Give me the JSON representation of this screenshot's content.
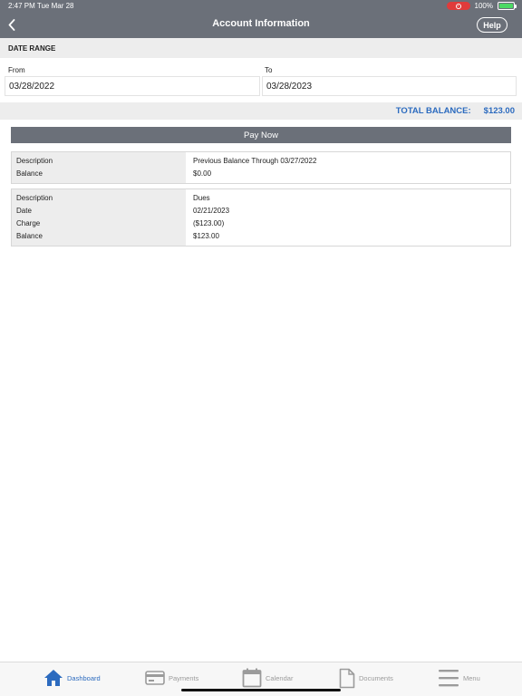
{
  "status": {
    "time_date": "2:47 PM   Tue Mar 28",
    "battery": "100%"
  },
  "nav": {
    "title": "Account Information",
    "help_label": "Help"
  },
  "date_range": {
    "section_title": "DATE RANGE",
    "from_label": "From",
    "from_value": "03/28/2022",
    "to_label": "To",
    "to_value": "03/28/2023"
  },
  "total_balance": {
    "label": "TOTAL BALANCE:",
    "value": "$123.00"
  },
  "pay_now_label": "Pay Now",
  "entries": [
    {
      "labels": [
        "Description",
        "Balance"
      ],
      "values": [
        "Previous Balance Through 03/27/2022",
        "$0.00"
      ]
    },
    {
      "labels": [
        "Description",
        "Date",
        "Charge",
        "Balance"
      ],
      "values": [
        "Dues",
        "02/21/2023",
        "($123.00)",
        "$123.00"
      ]
    }
  ],
  "tabs": [
    {
      "label": "Dashboard",
      "icon": "home-icon",
      "active": true
    },
    {
      "label": "Payments",
      "icon": "credit-card-icon",
      "active": false
    },
    {
      "label": "Calendar",
      "icon": "calendar-icon",
      "active": false
    },
    {
      "label": "Documents",
      "icon": "document-icon",
      "active": false
    },
    {
      "label": "Menu",
      "icon": "menu-icon",
      "active": false
    }
  ],
  "colors": {
    "header": "#6b7079",
    "accent": "#2c6bbf",
    "section_bg": "#ededed"
  }
}
